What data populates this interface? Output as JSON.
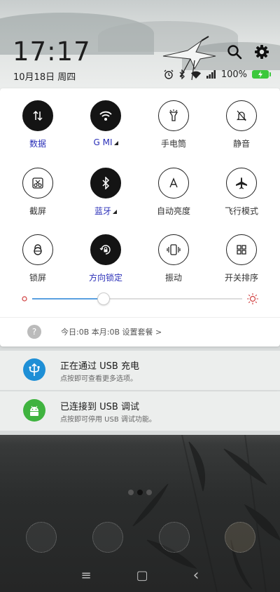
{
  "status": {
    "time": "17:17",
    "date": "10月18日 周四",
    "battery_text": "100%"
  },
  "tiles": [
    {
      "label": "数据",
      "active": true,
      "icon": "data-arrows-icon"
    },
    {
      "label": "G  MI",
      "active": true,
      "icon": "wifi-icon"
    },
    {
      "label": "手电筒",
      "active": false,
      "icon": "flashlight-icon"
    },
    {
      "label": "静音",
      "active": false,
      "icon": "mute-bell-icon"
    },
    {
      "label": "截屏",
      "active": false,
      "icon": "screenshot-scissors-icon"
    },
    {
      "label": "蓝牙",
      "active": true,
      "icon": "bluetooth-icon"
    },
    {
      "label": "自动亮度",
      "active": false,
      "icon": "auto-brightness-icon"
    },
    {
      "label": "飞行模式",
      "active": false,
      "icon": "airplane-icon"
    },
    {
      "label": "锁屏",
      "active": false,
      "icon": "lock-icon"
    },
    {
      "label": "方向锁定",
      "active": true,
      "icon": "rotation-lock-icon"
    },
    {
      "label": "振动",
      "active": false,
      "icon": "vibrate-icon"
    },
    {
      "label": "开关排序",
      "active": false,
      "icon": "grid-sort-icon"
    }
  ],
  "brightness": {
    "level": 0.34
  },
  "data_usage": {
    "text": "今日:0B   本月:0B   设置套餐 >"
  },
  "notifications": [
    {
      "title": "正在通过 USB 充电",
      "subtitle": "点按即可查看更多选项。",
      "icon": "usb-icon",
      "color": "#1e8fd6"
    },
    {
      "title": "已连接到 USB 调试",
      "subtitle": "点按即可停用 USB 调试功能。",
      "icon": "android-icon",
      "color": "#3fb33f"
    }
  ],
  "nav": {
    "menu": "≡",
    "home": "▢",
    "back": "‹"
  }
}
